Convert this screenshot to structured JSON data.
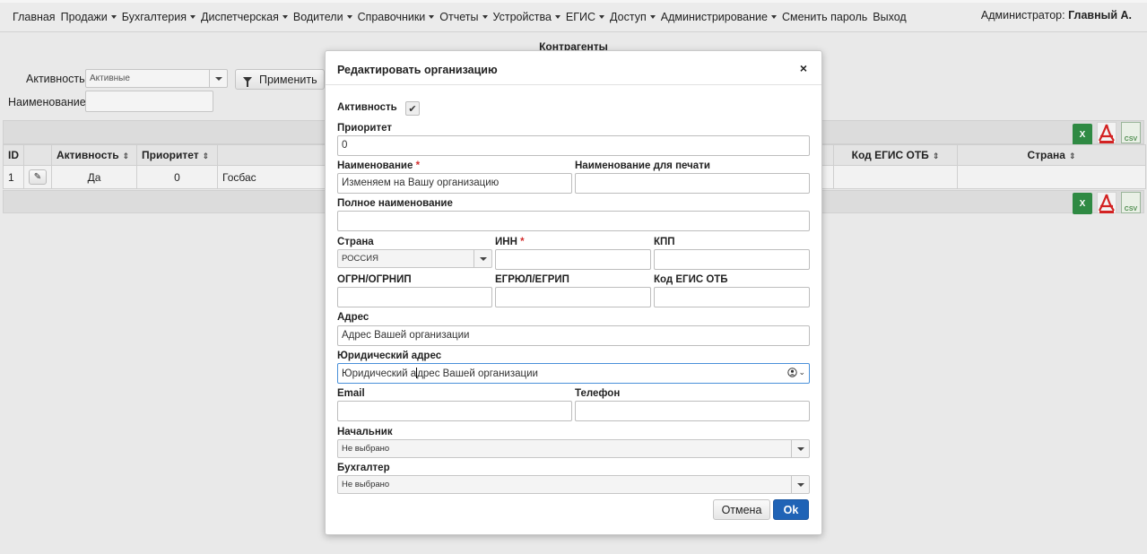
{
  "nav": {
    "items": [
      {
        "label": "Главная",
        "dropdown": false
      },
      {
        "label": "Продажи",
        "dropdown": true
      },
      {
        "label": "Бухгалтерия",
        "dropdown": true
      },
      {
        "label": "Диспетчерская",
        "dropdown": true
      },
      {
        "label": "Водители",
        "dropdown": true
      },
      {
        "label": "Справочники",
        "dropdown": true
      },
      {
        "label": "Отчеты",
        "dropdown": true
      },
      {
        "label": "Устройства",
        "dropdown": true
      },
      {
        "label": "ЕГИС",
        "dropdown": true
      },
      {
        "label": "Доступ",
        "dropdown": true
      },
      {
        "label": "Администрирование",
        "dropdown": true
      },
      {
        "label": "Сменить пароль",
        "dropdown": false
      },
      {
        "label": "Выход",
        "dropdown": false
      }
    ],
    "user_prefix": "Администратор:",
    "user_name": "Главный А."
  },
  "page": {
    "title": "Контрагенты",
    "filter_activity_label": "Активность",
    "filter_activity_value": "Активные",
    "filter_name_label": "Наименование",
    "filter_name_value": "",
    "apply_label": "Применить"
  },
  "export": {
    "xls": "X",
    "pdf": "PDF",
    "csv": "CSV"
  },
  "table": {
    "columns": [
      "ID",
      "",
      "Активность",
      "Приоритет",
      "",
      "Код ЕГИС ОТБ",
      "Страна"
    ],
    "rows": [
      {
        "id": "1",
        "active": "Да",
        "priority": "0",
        "name": "Госбас",
        "egis": "",
        "country": ""
      }
    ]
  },
  "modal": {
    "title": "Редактировать организацию",
    "close": "×",
    "active_label": "Активность",
    "active_checked": true,
    "priority_label": "Приоритет",
    "priority_value": "0",
    "name_label": "Наименование",
    "name_value": "Изменяем на Вашу организацию",
    "print_name_label": "Наименование для печати",
    "print_name_value": "",
    "full_name_label": "Полное наименование",
    "full_name_value": "",
    "country_label": "Страна",
    "country_value": "РОССИЯ",
    "inn_label": "ИНН",
    "inn_value": "",
    "kpp_label": "КПП",
    "kpp_value": "",
    "ogrn_label": "ОГРН/ОГРНИП",
    "ogrn_value": "",
    "egrul_label": "ЕГРЮЛ/ЕГРИП",
    "egrul_value": "",
    "egis_label": "Код ЕГИС ОТБ",
    "egis_value": "",
    "address_label": "Адрес",
    "address_value": "Адрес Вашей организации",
    "legal_address_label": "Юридический адрес",
    "legal_address_before_cursor": "Юридический а",
    "legal_address_after_cursor": "дрес Вашей организации",
    "email_label": "Email",
    "email_value": "",
    "phone_label": "Телефон",
    "phone_value": "",
    "chief_label": "Начальник",
    "chief_value": "Не выбрано",
    "accountant_label": "Бухгалтер",
    "accountant_value": "Не выбрано",
    "cancel_label": "Отмена",
    "ok_label": "Ok",
    "required_mark": "*"
  }
}
